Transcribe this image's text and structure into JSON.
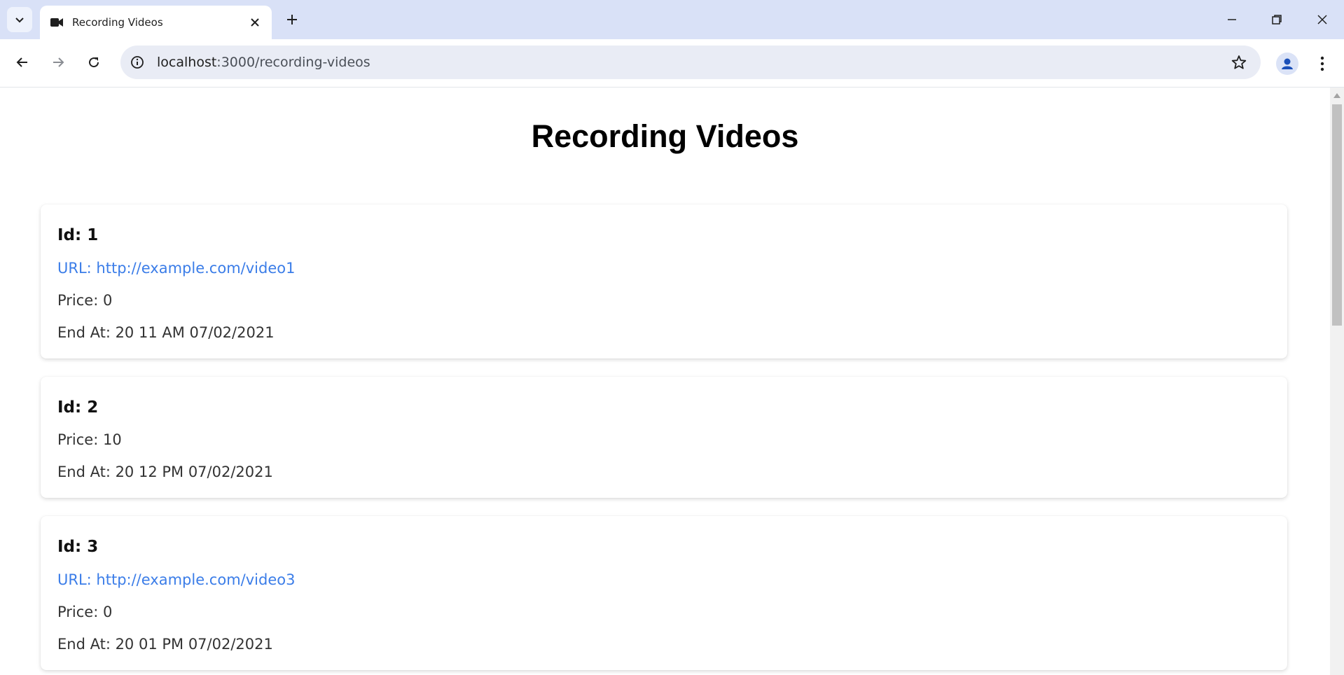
{
  "browser": {
    "tab_title": "Recording Videos",
    "url_host": "localhost",
    "url_path": ":3000/recording-videos"
  },
  "page": {
    "title": "Recording Videos"
  },
  "videos": [
    {
      "id_label": "Id: 1",
      "url_label": "URL: http://example.com/video1",
      "price_label": "Price: 0",
      "end_label": "End At: 20 11 AM 07/02/2021"
    },
    {
      "id_label": "Id: 2",
      "price_label": "Price: 10",
      "end_label": "End At: 20 12 PM 07/02/2021"
    },
    {
      "id_label": "Id: 3",
      "url_label": "URL: http://example.com/video3",
      "price_label": "Price: 0",
      "end_label": "End At: 20 01 PM 07/02/2021"
    }
  ],
  "colors": {
    "link": "#3b7de8",
    "tabstrip": "#d9e1f7",
    "omnibox": "#e9ecf5"
  },
  "icons": [
    "tab-search-icon",
    "video-camera-icon",
    "close-icon",
    "plus-icon",
    "minimize-icon",
    "restore-icon",
    "back-icon",
    "forward-icon",
    "reload-icon",
    "site-info-icon",
    "star-icon",
    "profile-icon",
    "kebab-menu-icon"
  ]
}
